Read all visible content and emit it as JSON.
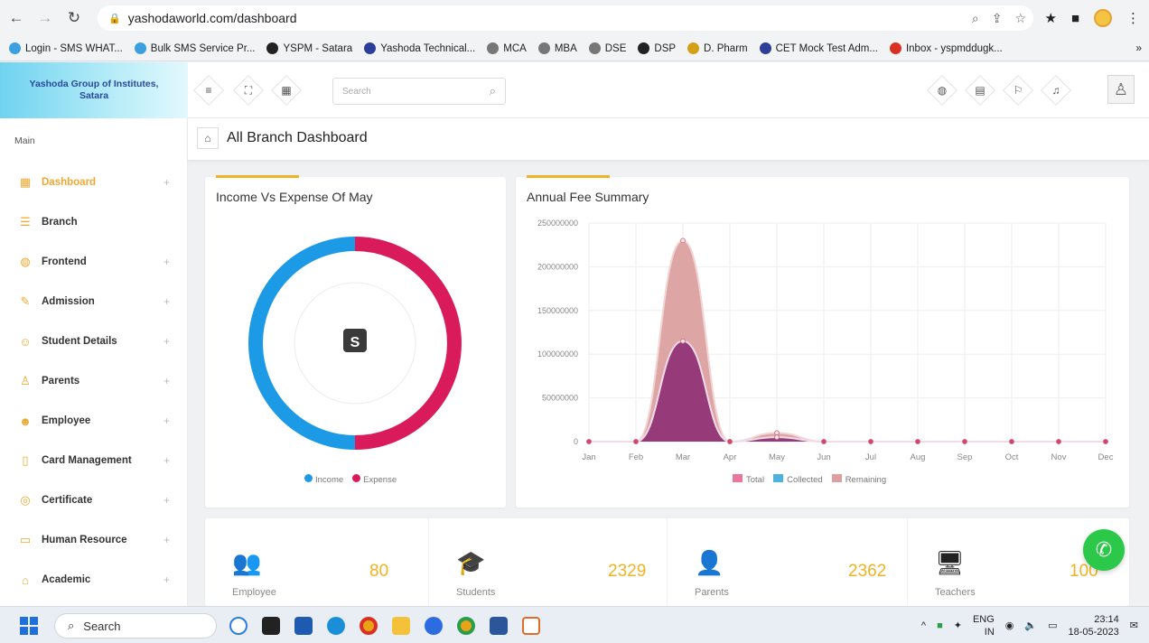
{
  "browser": {
    "url": "yashodaworld.com/dashboard",
    "bookmarks": [
      {
        "label": "Login - SMS WHAT...",
        "color": "#3aa0e0"
      },
      {
        "label": "Bulk SMS Service Pr...",
        "color": "#3aa0e0"
      },
      {
        "label": "YSPM - Satara",
        "color": "#222222"
      },
      {
        "label": "Yashoda Technical...",
        "color": "#2c3e9a"
      },
      {
        "label": "MCA",
        "color": "#777777"
      },
      {
        "label": "MBA",
        "color": "#777777"
      },
      {
        "label": "DSE",
        "color": "#777777"
      },
      {
        "label": "DSP",
        "color": "#222222"
      },
      {
        "label": "D. Pharm",
        "color": "#d4a017"
      },
      {
        "label": "CET Mock Test Adm...",
        "color": "#2c3e9a"
      },
      {
        "label": "Inbox - yspmddugk...",
        "color": "#d93025"
      }
    ],
    "more": "»"
  },
  "brand": {
    "line1": "Yashoda Group of Institutes,",
    "line2": "Satara"
  },
  "header": {
    "search_placeholder": "Search"
  },
  "sidebar": {
    "section": "Main",
    "items": [
      {
        "label": "Dashboard",
        "icon": "grid-icon",
        "glyph": "▦",
        "plus": "+",
        "active": true
      },
      {
        "label": "Branch",
        "icon": "branch-icon",
        "glyph": "☰",
        "plus": ""
      },
      {
        "label": "Frontend",
        "icon": "globe-icon",
        "glyph": "◍",
        "plus": "+"
      },
      {
        "label": "Admission",
        "icon": "form-icon",
        "glyph": "✎",
        "plus": "+"
      },
      {
        "label": "Student Details",
        "icon": "student-icon",
        "glyph": "☺",
        "plus": "+"
      },
      {
        "label": "Parents",
        "icon": "parent-icon",
        "glyph": "♙",
        "plus": "+"
      },
      {
        "label": "Employee",
        "icon": "employee-icon",
        "glyph": "☻",
        "plus": "+"
      },
      {
        "label": "Card Management",
        "icon": "card-icon",
        "glyph": "▯",
        "plus": "+"
      },
      {
        "label": "Certificate",
        "icon": "certificate-icon",
        "glyph": "◎",
        "plus": "+"
      },
      {
        "label": "Human Resource",
        "icon": "hr-icon",
        "glyph": "▭",
        "plus": "+"
      },
      {
        "label": "Academic",
        "icon": "academic-icon",
        "glyph": "⌂",
        "plus": "+"
      }
    ]
  },
  "page": {
    "title": "All Branch Dashboard"
  },
  "donut": {
    "title": "Income Vs Expense Of May",
    "center_symbol": "S",
    "legend": [
      {
        "label": "Income",
        "color": "#1d9ae6"
      },
      {
        "label": "Expense",
        "color": "#d91a5b"
      }
    ],
    "values": {
      "income": 50,
      "expense": 50
    }
  },
  "chart_data": {
    "type": "area",
    "title": "Annual Fee Summary",
    "categories": [
      "Jan",
      "Feb",
      "Mar",
      "Apr",
      "May",
      "Jun",
      "Jul",
      "Aug",
      "Sep",
      "Oct",
      "Nov",
      "Dec"
    ],
    "ylim": [
      0,
      250000000
    ],
    "yticks": [
      "0",
      "50000000",
      "100000000",
      "150000000",
      "200000000",
      "250000000"
    ],
    "series": [
      {
        "name": "Total",
        "color": "#e9769b",
        "values": [
          0,
          0,
          230000000,
          0,
          10000000,
          0,
          0,
          0,
          0,
          0,
          0,
          0
        ]
      },
      {
        "name": "Collected",
        "color": "#4cb3de",
        "values": [
          0,
          0,
          115000000,
          0,
          5000000,
          0,
          0,
          0,
          0,
          0,
          0,
          0
        ]
      },
      {
        "name": "Remaining",
        "color": "#dca0a0",
        "values": [
          0,
          0,
          115000000,
          0,
          5000000,
          0,
          0,
          0,
          0,
          0,
          0,
          0
        ]
      }
    ]
  },
  "stats": [
    {
      "label": "Employee",
      "value": "80",
      "icon": "employees-icon",
      "glyph": "👥"
    },
    {
      "label": "Students",
      "value": "2329",
      "icon": "graduate-icon",
      "glyph": "🎓"
    },
    {
      "label": "Parents",
      "value": "2362",
      "icon": "parent-person-icon",
      "glyph": "👤"
    },
    {
      "label": "Teachers",
      "value": "100",
      "icon": "teacher-icon",
      "glyph": "🖥"
    }
  ],
  "taskbar": {
    "search": "Search",
    "lang1": "ENG",
    "lang2": "IN",
    "time": "23:14",
    "date": "18-05-2023"
  }
}
